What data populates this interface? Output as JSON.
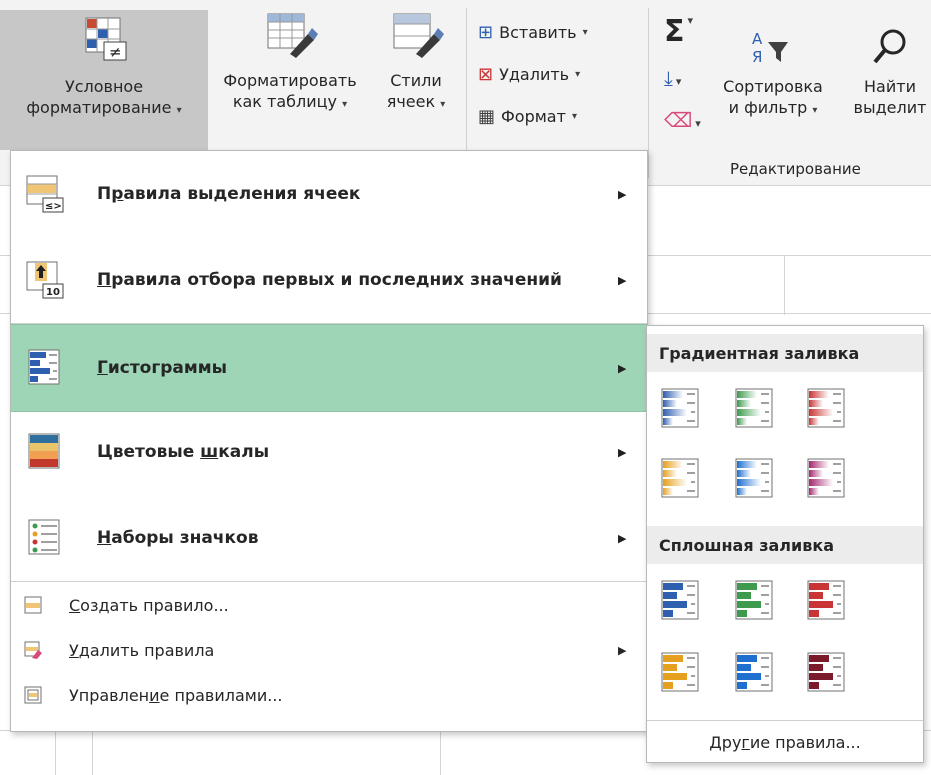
{
  "ribbon": {
    "conditional_formatting": {
      "line1": "Условное",
      "line2": "форматирование"
    },
    "format_as_table": {
      "line1": "Форматировать",
      "line2": "как таблицу"
    },
    "cell_styles": {
      "line1": "Стили",
      "line2": "ячеек"
    },
    "cells_group": {
      "insert": "Вставить",
      "delete": "Удалить",
      "format": "Формат"
    },
    "editing_group": {
      "sort_filter": {
        "line1": "Сортировка",
        "line2": "и фильтр"
      },
      "find_select": {
        "line1": "Найти",
        "line2": "выделит"
      },
      "label": "Редактирование"
    }
  },
  "menu": {
    "items": [
      {
        "label_prefix": "П",
        "label_ul": "р",
        "label_rest": "авила выделения ячеек",
        "icon": "highlight-cells-rules-icon"
      },
      {
        "label_prefix": "",
        "label_ul": "П",
        "label_rest": "равила отбора первых и последних значений",
        "icon": "top-bottom-rules-icon"
      },
      {
        "label_prefix": "",
        "label_ul": "Г",
        "label_rest": "истограммы",
        "icon": "data-bars-icon"
      },
      {
        "label_prefix": "Цветовые ",
        "label_ul": "ш",
        "label_rest": "калы",
        "icon": "color-scales-icon"
      },
      {
        "label_prefix": "",
        "label_ul": "Н",
        "label_rest": "аборы значков",
        "icon": "icon-sets-icon"
      }
    ],
    "commands": [
      {
        "label_prefix": "",
        "label_ul": "С",
        "label_rest": "оздать правило...",
        "icon": "new-rule-icon"
      },
      {
        "label_prefix": "",
        "label_ul": "У",
        "label_rest": "далить правила",
        "icon": "clear-rules-icon"
      },
      {
        "label_prefix": "Управлен",
        "label_ul": "и",
        "label_rest": "е правилами...",
        "icon": "manage-rules-icon"
      }
    ]
  },
  "submenu": {
    "gradient_header": "Градиентная заливка",
    "solid_header": "Сплошная заливка",
    "footer_prefix": "Дру",
    "footer_ul": "г",
    "footer_rest": "ие правила...",
    "colors": [
      "#2f5faf",
      "#3e9a4d",
      "#c93535",
      "#e6a020",
      "#1f6fd0",
      "#a6286e"
    ],
    "solid_colors": [
      "#2f5faf",
      "#3e9a4d",
      "#c93535",
      "#e6a020",
      "#1f6fd0",
      "#7a1a2a"
    ]
  },
  "colors": {
    "active_item": "#9fd5b7",
    "pressed_button": "#c7c7c7"
  }
}
